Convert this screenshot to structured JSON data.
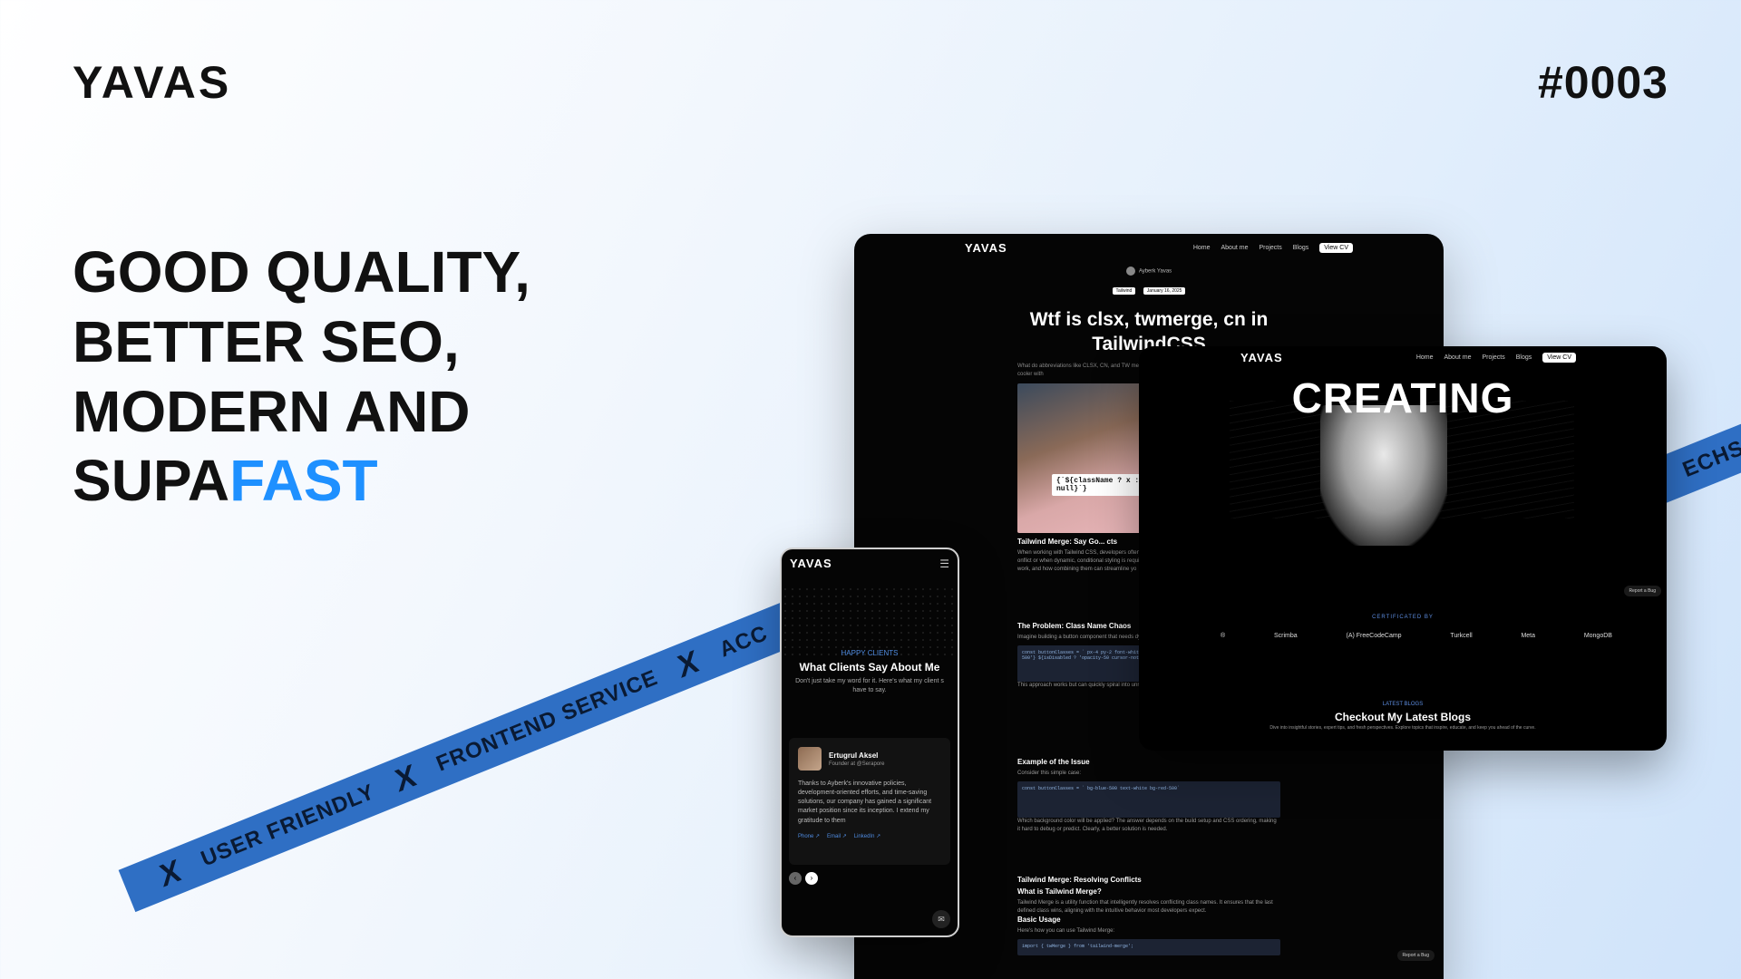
{
  "brand": {
    "logo": "YAVAS",
    "issue": "#0003"
  },
  "headline": {
    "line1": "GOOD QUALITY,",
    "line2": "BETTER SEO,",
    "line3": "MODERN AND",
    "line4_a": "SUPA",
    "line4_b": "FAST"
  },
  "ribbon_left": {
    "items": [
      "USER FRIENDLY",
      "FRONTEND SERVICE",
      "ACC"
    ]
  },
  "ribbon_right": {
    "text": "ECHS"
  },
  "blog": {
    "nav": {
      "brand": "YAVAS",
      "items": [
        "Home",
        "About me",
        "Projects",
        "Blogs"
      ],
      "cv": "View CV"
    },
    "author": "Ayberk Yavas",
    "tags": [
      "Tailwind",
      "January 16, 2025"
    ],
    "title": "Wtf is clsx, twmerge, cn in TailwindCSS",
    "intro": "What do abbreviations like CLSX, CN, and TW mean in className management functions, explain what cooler with",
    "hero_code": "{`${className ? x : null}`}",
    "s1_title": "Tailwind Merge: Say Go... cts",
    "s1_text": "When working with Tailwind CSS, developers often... efficiently. Tailwind's utility-first approach is incredi... onflict or when dynamic, conditional styling is requi... lass management and eliminate the guesswork. In t... y work, and how combining them can streamline yo",
    "s2_title": "The Problem: Class Name Chaos",
    "s2_text": "Imagine building a button component that needs dy... or custom user input. Without any helper tools, yo",
    "s3_text": "This approach works but can quickly spiral into unre... ad to unpredictable results.",
    "s4_title": "Example of the Issue",
    "s4_text": "Consider this simple case:",
    "s5_text": "Which background color will be applied? The answer depends on the build setup and CSS ordering, making it hard to debug or predict. Clearly, a better solution is needed.",
    "s6_title": "Tailwind Merge: Resolving Conflicts",
    "s6_sub": "What is Tailwind Merge?",
    "s6_text": "Tailwind Merge is a utility function that intelligently resolves conflicting class names. It ensures that the last defined class wins, aligning with the intuitive behavior most developers expect.",
    "s7_title": "Basic Usage",
    "s7_text": "Here's how you can use Tailwind Merge:",
    "code1": "const buttonClasses = ` px-4 py-2 font-white rounded ${isLoading ? 'bg-gray-500' : 'bg-blue-500'} ${isDisabled ? 'opacity-50 cursor-not-allowed' : ''}`",
    "code2": "const buttonClasses = ` bg-blue-500 text-white bg-red-500`",
    "code3": "import { twMerge } from 'tailwind-merge';",
    "report": "Report a Bug"
  },
  "tablet": {
    "nav": {
      "brand": "YAVAS",
      "items": [
        "Home",
        "About me",
        "Projects",
        "Blogs"
      ],
      "cv": "View CV"
    },
    "hero": "CREATING",
    "certified": "CERTIFICATED BY",
    "logos": [
      "®",
      "Scrimba",
      "(A) FreeCodeCamp",
      "Turkcell",
      "Meta",
      "MongoDB"
    ],
    "latest_label": "LATEST BLOGS",
    "latest_title": "Checkout My Latest Blogs",
    "latest_sub": "Dive into insightful stories, expert tips, and fresh perspectives. Explore topics that inspire, educate, and keep you ahead of the curve.",
    "report": "Report a Bug"
  },
  "phone": {
    "brand": "YAVAS",
    "eyebrow": "HAPPY CLIENTS",
    "title": "What Clients Say About Me",
    "sub": "Don't just take my word for it. Here's what my client s have to say.",
    "name": "Ertugrul Aksel",
    "role": "Founder at @Serapore",
    "quote": "Thanks to Ayberk's innovative policies, development-oriented efforts, and time-saving solutions, our company has gained a significant market position since its inception. I extend my gratitude to them",
    "links": [
      "Phone ↗",
      "Email ↗",
      "LinkedIn ↗"
    ]
  }
}
